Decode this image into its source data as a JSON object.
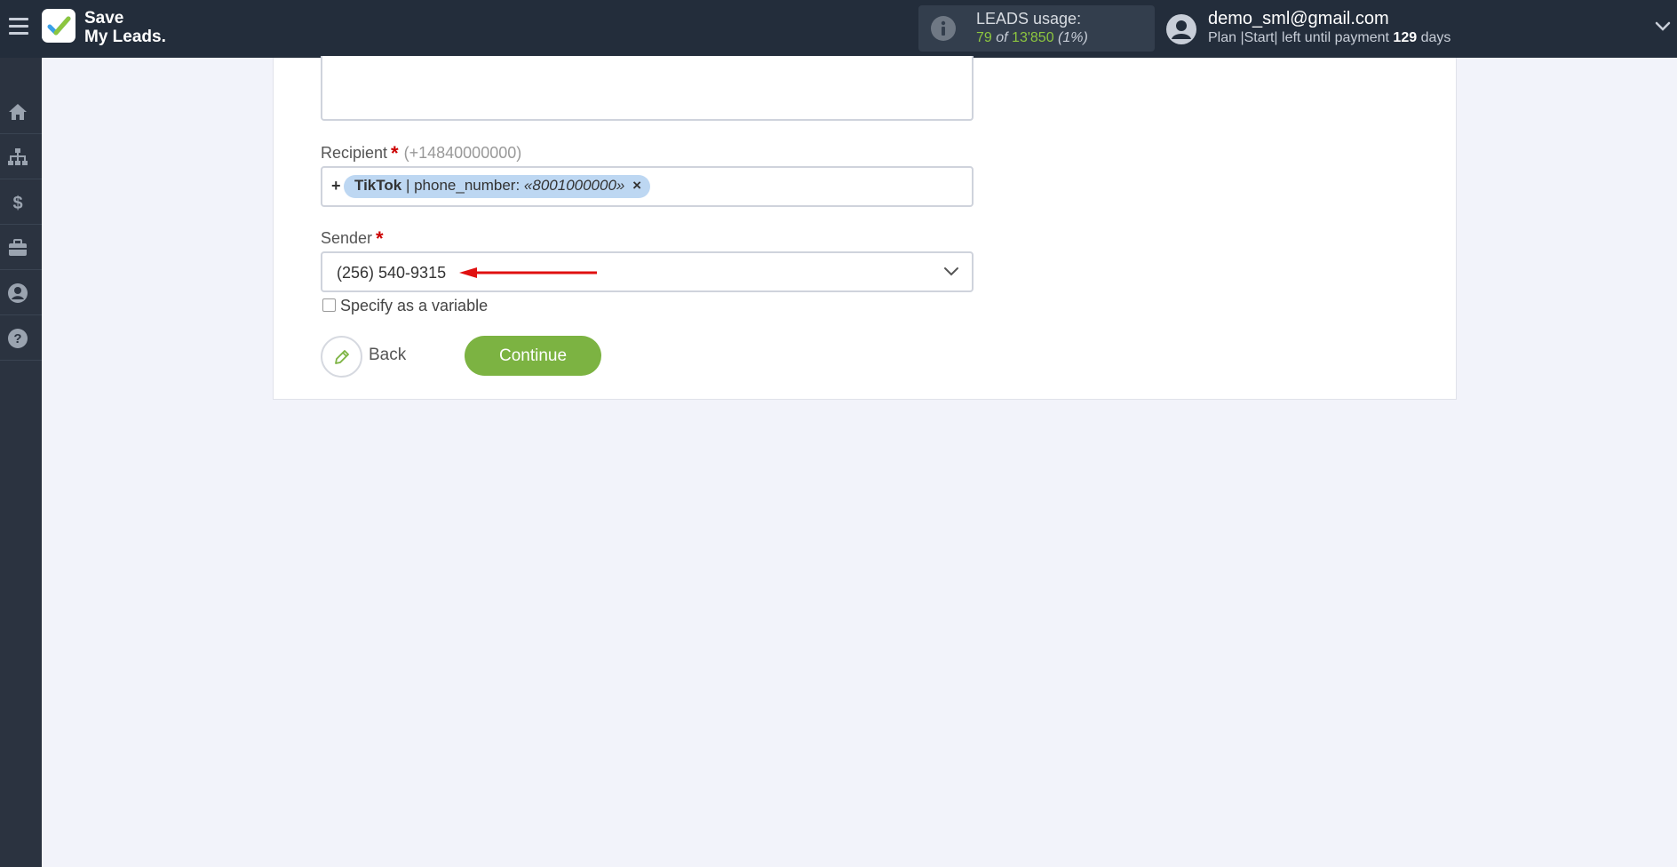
{
  "app": {
    "logo_line1": "Save",
    "logo_line2": "My Leads."
  },
  "leads": {
    "title": "LEADS usage:",
    "used": "79",
    "of_label": "of",
    "total": "13'850",
    "percent": "(1%)"
  },
  "user": {
    "email": "demo_sml@gmail.com",
    "plan_prefix": "Plan |Start| left until payment",
    "days_value": "129",
    "days_label": "days"
  },
  "sidebar": {
    "items": [
      {
        "icon": "home-icon"
      },
      {
        "icon": "sitemap-icon"
      },
      {
        "icon": "dollar-icon"
      },
      {
        "icon": "briefcase-icon"
      },
      {
        "icon": "user-icon"
      },
      {
        "icon": "help-icon"
      }
    ]
  },
  "form": {
    "recipient": {
      "label": "Recipient",
      "required": "*",
      "hint": "(+14840000000)",
      "plus": "+",
      "tag_source": "TikTok",
      "tag_sep": "| phone_number:",
      "tag_value": "«8001000000»",
      "tag_remove": "×"
    },
    "sender": {
      "label": "Sender",
      "required": "*",
      "value": "(256) 540-9315"
    },
    "specify_variable_label": "Specify as a variable",
    "back_label": "Back",
    "continue_label": "Continue"
  },
  "colors": {
    "topbar": "#232d3b",
    "sidebar": "#2b3340",
    "accent_green": "#7cb342",
    "arrow_red": "#e01010",
    "tag_blue": "#bdd7f2"
  }
}
